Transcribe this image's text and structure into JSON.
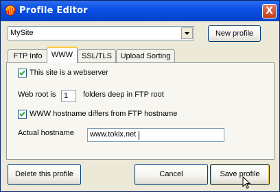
{
  "window": {
    "title": "Profile Editor",
    "close_glyph": "X"
  },
  "profile_select": {
    "value": "MySite"
  },
  "buttons": {
    "new_profile": "New profile",
    "delete_profile": "Delete this profile",
    "cancel": "Cancel",
    "save_profile": "Save profile"
  },
  "tabs": [
    {
      "label": "FTP Info",
      "active": false
    },
    {
      "label": "WWW",
      "active": true
    },
    {
      "label": "SSL/TLS",
      "active": false
    },
    {
      "label": "Upload Sorting",
      "active": false
    }
  ],
  "www": {
    "is_webserver": {
      "label": "This site is a webserver",
      "checked": true
    },
    "web_root": {
      "prefix": "Web root is",
      "value": "1",
      "suffix": "folders deep in FTP root"
    },
    "hostname_differs": {
      "label": "WWW hostname differs from FTP hostname",
      "checked": true
    },
    "actual_hostname": {
      "label": "Actual hostname",
      "value": "www.tokix.net"
    }
  },
  "icons": {
    "app": "shell-icon",
    "close": "close-icon",
    "dropdown": "chevron-down-icon",
    "check": "check-icon",
    "pointer": "mouse-pointer-icon"
  }
}
